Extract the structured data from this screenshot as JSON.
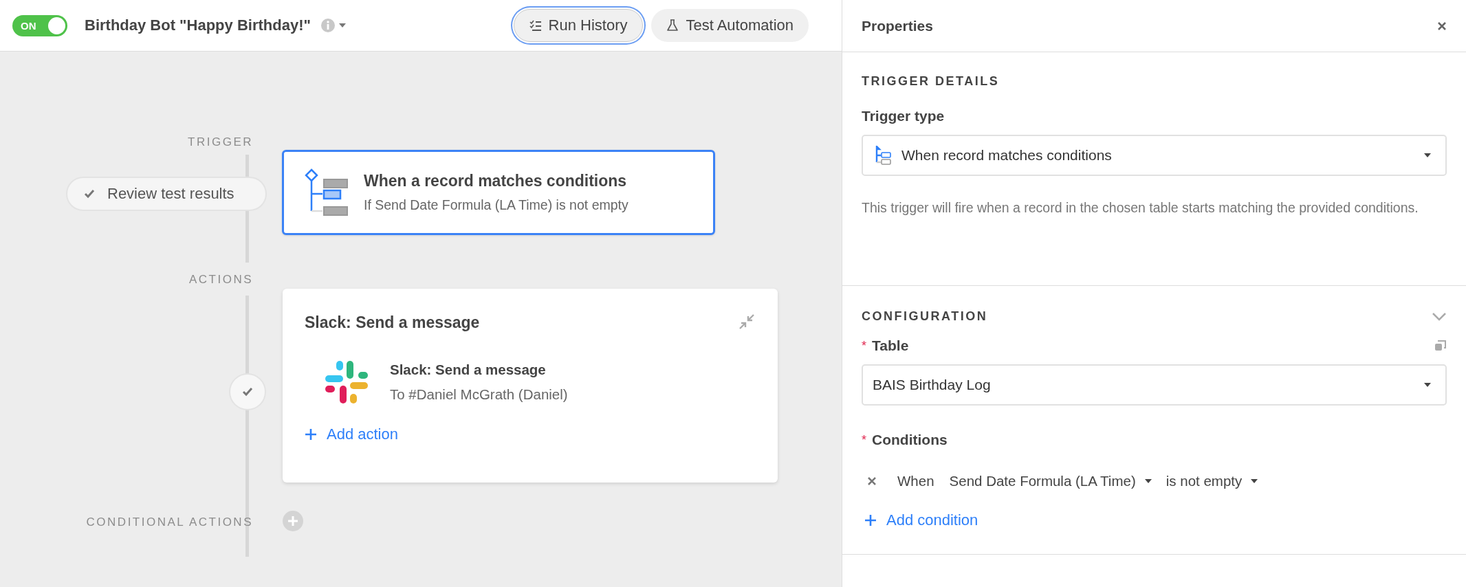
{
  "toggle": {
    "label": "ON",
    "on": true
  },
  "title": "Birthday Bot \"Happy Birthday!\"",
  "toolbar": [
    {
      "label": "Run History",
      "kind": "history",
      "selected": true
    },
    {
      "label": "Test Automation",
      "kind": "test",
      "selected": false
    }
  ],
  "canvas": {
    "trigger_label": "TRIGGER",
    "review_button": {
      "label": "Review test results"
    },
    "trigger_card": {
      "title": "When a record matches conditions",
      "subtitle": "If Send Date Formula (LA Time) is not empty",
      "selected": true
    },
    "actions_label": "ACTIONS",
    "action_card": {
      "title": "Slack: Send a message",
      "steps": [
        {
          "title": "Slack: Send a message",
          "subtitle": "To #Daniel McGrath (Daniel)",
          "tested": true
        }
      ],
      "add_label": "Add action"
    },
    "conditional_label": "CONDITIONAL ACTIONS"
  },
  "properties": {
    "title": "Properties",
    "trigger_details": {
      "heading": "TRIGGER DETAILS",
      "type_label": "Trigger type",
      "type_value": "When record matches conditions",
      "description": "This trigger will fire when a record in the chosen table starts matching the provided conditions."
    },
    "configuration": {
      "heading": "CONFIGURATION",
      "expanded": true,
      "table": {
        "marker": "*",
        "label": "Table",
        "value": "BAIS Birthday Log"
      },
      "conditions_field": {
        "marker": "*",
        "label": "Conditions"
      },
      "conditions": [
        {
          "prefix": "When",
          "field": "Send Date Formula (LA Time)",
          "operator": "is not empty"
        }
      ],
      "add_label": "Add condition"
    }
  }
}
